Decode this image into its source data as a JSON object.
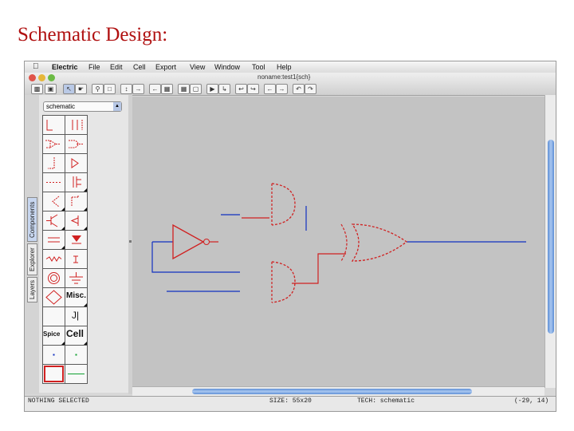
{
  "slide": {
    "title": "Schematic Design:"
  },
  "menubar": {
    "app_icon": "apple-icon",
    "items": [
      "Electric",
      "File",
      "Edit",
      "Cell",
      "Export",
      "View",
      "Window",
      "Tool",
      "Help"
    ]
  },
  "window": {
    "title": "noname:test1{sch}"
  },
  "sidebar": {
    "tabs": [
      "Components",
      "Explorer",
      "Layers"
    ],
    "active_tab": "Components",
    "technology_select": "schematic",
    "palette_labels": {
      "misc": "Misc.",
      "spice": "Spice",
      "cell": "Cell"
    }
  },
  "status": {
    "selection": "NOTHING SELECTED",
    "size": "SIZE: 55x20",
    "tech": "TECH: schematic",
    "coords": "(-29, 14)"
  },
  "colors": {
    "wire": "#1030c0",
    "component": "#d02020",
    "canvas_bg": "#c3c3c3",
    "scroll_thumb": "#5e8fd6"
  }
}
